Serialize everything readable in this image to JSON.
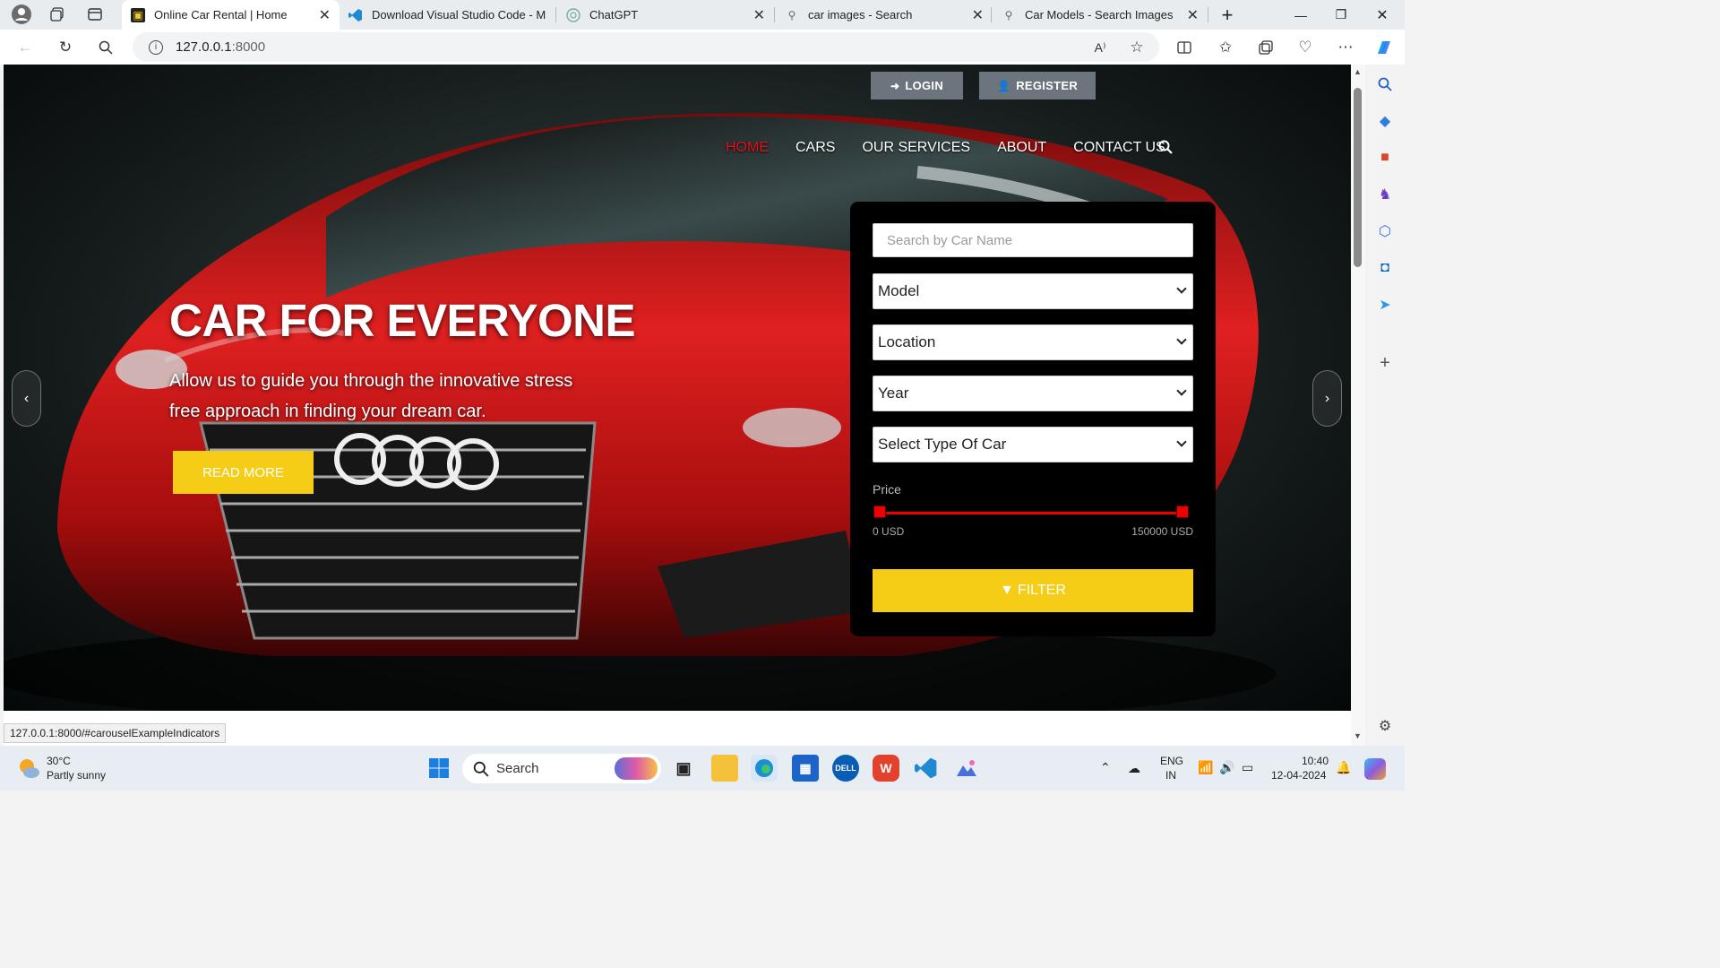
{
  "tabs": [
    {
      "title": "Online Car Rental | Home",
      "active": true
    },
    {
      "title": "Download Visual Studio Code - M",
      "active": false
    },
    {
      "title": "ChatGPT",
      "active": false
    },
    {
      "title": "car images - Search",
      "active": false
    },
    {
      "title": "Car Models - Search Images",
      "active": false
    }
  ],
  "address": {
    "host": "127.0.0.1",
    "port": ":8000"
  },
  "header": {
    "login": "LOGIN",
    "register": "REGISTER"
  },
  "nav": {
    "home": "HOME",
    "cars": "CARS",
    "services": "OUR SERVICES",
    "about": "ABOUT",
    "contact": "CONTACT US"
  },
  "hero": {
    "title": "CAR FOR EVERYONE",
    "text": "Allow us to guide you through the innovative stress free approach in finding your dream car.",
    "cta": "READ MORE"
  },
  "filter": {
    "search_placeholder": "Search by Car Name",
    "model": "Model",
    "location": "Location",
    "year": "Year",
    "type": "Select Type Of Car",
    "price_label": "Price",
    "price_min": "0 USD",
    "price_max": "150000 USD",
    "price_range_fraction": [
      0.0,
      1.0
    ],
    "button": "FILTER"
  },
  "status_url": "127.0.0.1:8000/#carouselExampleIndicators",
  "taskbar": {
    "weather_temp": "30°C",
    "weather_desc": "Partly sunny",
    "search": "Search",
    "lang1": "ENG",
    "lang2": "IN",
    "time": "10:40",
    "date": "12-04-2024"
  },
  "colors": {
    "accent_yellow": "#f6cd16",
    "nav_active": "#e4101d",
    "slider": "#ee0000"
  }
}
